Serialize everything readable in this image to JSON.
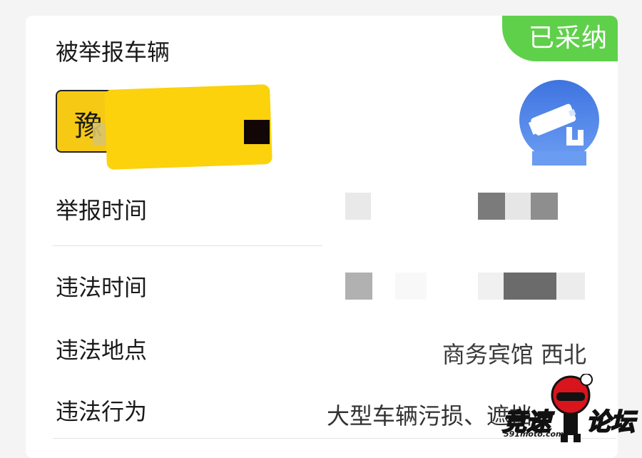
{
  "card": {
    "status_badge": "已采纳",
    "section_title": "被举报车辆",
    "plate": {
      "province_char": "豫",
      "color": "#f6c915"
    },
    "camera_icon": "surveillance-camera-icon"
  },
  "rows": {
    "report_time_label": "举报时间",
    "violation_time_label": "违法时间",
    "violation_location_label": "违法地点",
    "violation_location_value": "商务宾馆 西北",
    "violation_action_label": "违法行为",
    "violation_action_value": "大型车辆污损、遮挡"
  },
  "watermark": {
    "text_left": "竞速",
    "text_right": "论坛",
    "site": "591moto.com"
  },
  "colors": {
    "accepted_green": "#5fd04a",
    "camera_blue": "#4a7ee6"
  }
}
